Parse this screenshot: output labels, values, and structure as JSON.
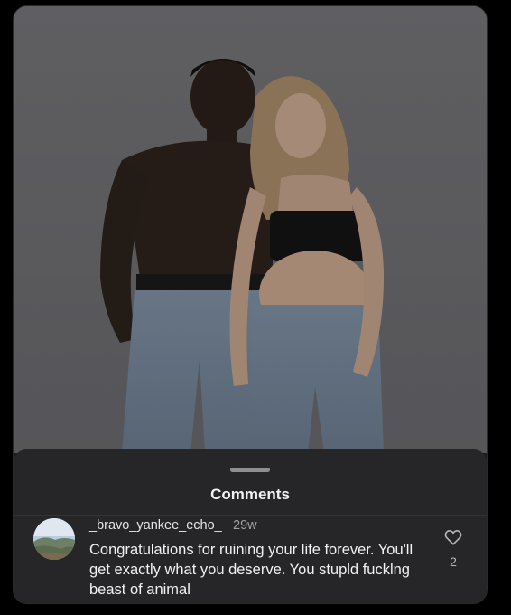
{
  "post": {
    "image_description_icon": "photo"
  },
  "comments_sheet": {
    "title": "Comments",
    "comment": {
      "username": "_bravo_yankee_echo_",
      "time_ago": "29w",
      "text": "Congratulations for ruining your life forever. You'll get exactly what you deserve. You stupld fucklng beast of animal",
      "like_icon": "heart-outline-icon",
      "like_count": "2"
    }
  },
  "colors": {
    "background": "#000000",
    "sheet": "#262628",
    "text_primary": "#f2f2f2",
    "text_secondary": "#a0a0a5"
  }
}
